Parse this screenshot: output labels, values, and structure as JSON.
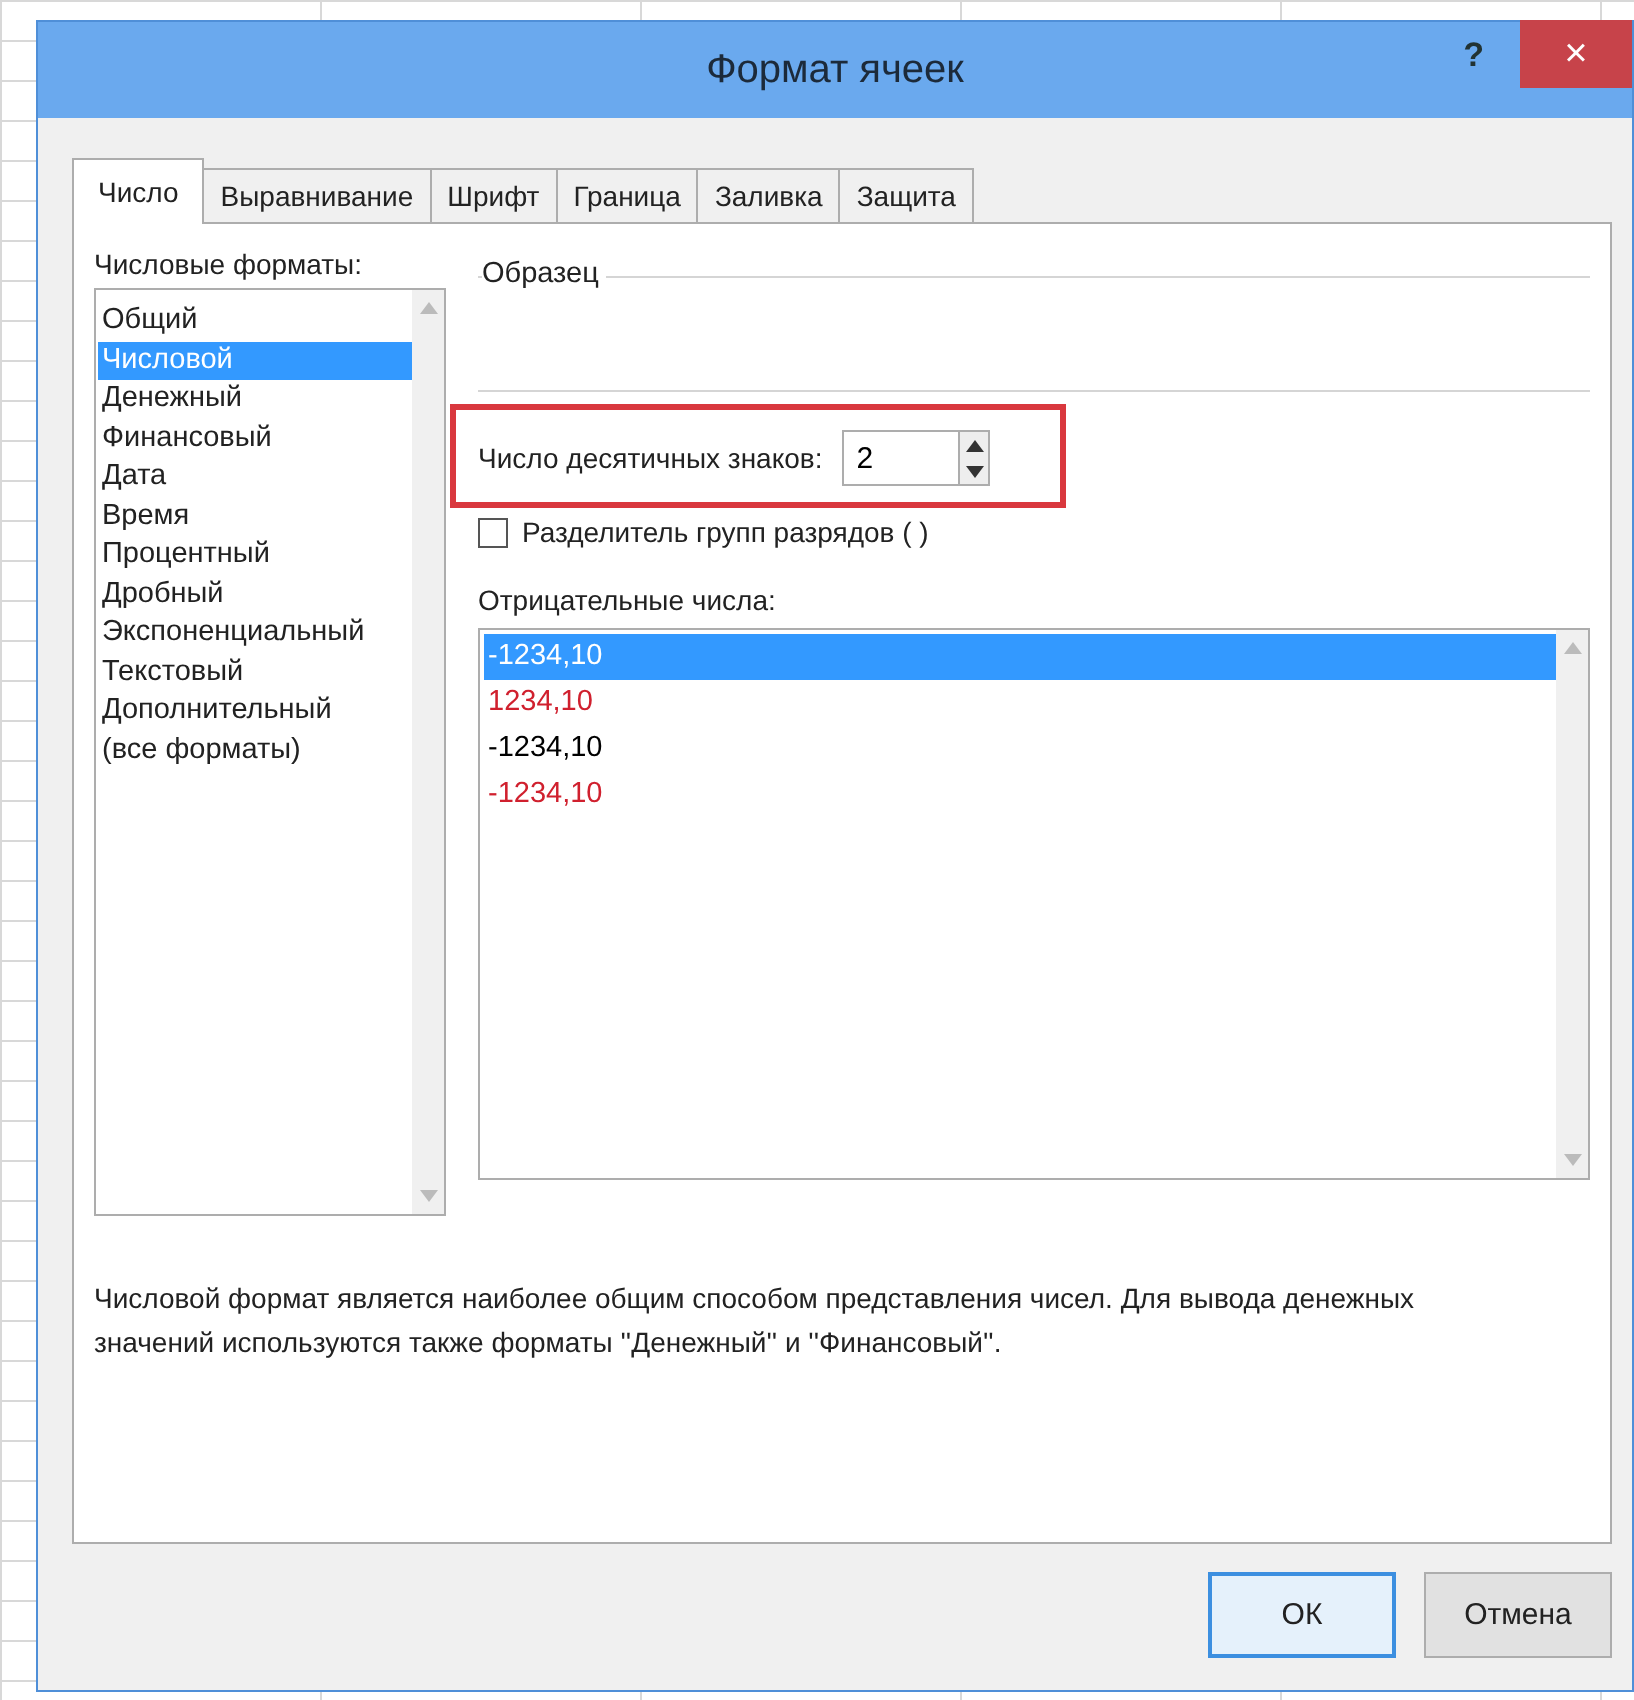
{
  "window": {
    "title": "Формат ячеек",
    "help": "?",
    "close": "×"
  },
  "tabs": [
    {
      "label": "Число",
      "selected": true
    },
    {
      "label": "Выравнивание",
      "selected": false
    },
    {
      "label": "Шрифт",
      "selected": false
    },
    {
      "label": "Граница",
      "selected": false
    },
    {
      "label": "Заливка",
      "selected": false
    },
    {
      "label": "Защита",
      "selected": false
    }
  ],
  "formats": {
    "label": "Числовые форматы:",
    "items": [
      {
        "label": "Общий",
        "selected": false
      },
      {
        "label": "Числовой",
        "selected": true
      },
      {
        "label": "Денежный",
        "selected": false
      },
      {
        "label": "Финансовый",
        "selected": false
      },
      {
        "label": "Дата",
        "selected": false
      },
      {
        "label": "Время",
        "selected": false
      },
      {
        "label": "Процентный",
        "selected": false
      },
      {
        "label": "Дробный",
        "selected": false
      },
      {
        "label": "Экспоненциальный",
        "selected": false
      },
      {
        "label": "Текстовый",
        "selected": false
      },
      {
        "label": "Дополнительный",
        "selected": false
      },
      {
        "label": "(все форматы)",
        "selected": false
      }
    ]
  },
  "sample": {
    "label": "Образец"
  },
  "decimals": {
    "label": "Число десятичных знаков:",
    "value": "2"
  },
  "separator": {
    "label": "Разделитель групп разрядов ( )",
    "checked": false
  },
  "negative": {
    "label": "Отрицательные числа:",
    "items": [
      {
        "label": "-1234,10",
        "selected": true
      },
      {
        "label": "1234,10",
        "color": "#d0202e",
        "selected": false
      },
      {
        "label": "-1234,10",
        "color": "#000000",
        "selected": false
      },
      {
        "label": "-1234,10",
        "color": "#d0202e",
        "selected": false
      }
    ]
  },
  "description": "Числовой формат является наиболее общим способом представления чисел. Для вывода денежных значений используются также форматы ''Денежный'' и ''Финансовый''.",
  "buttons": [
    {
      "label": "ОК",
      "kind": "default"
    },
    {
      "label": "Отмена",
      "kind": "normal"
    }
  ]
}
